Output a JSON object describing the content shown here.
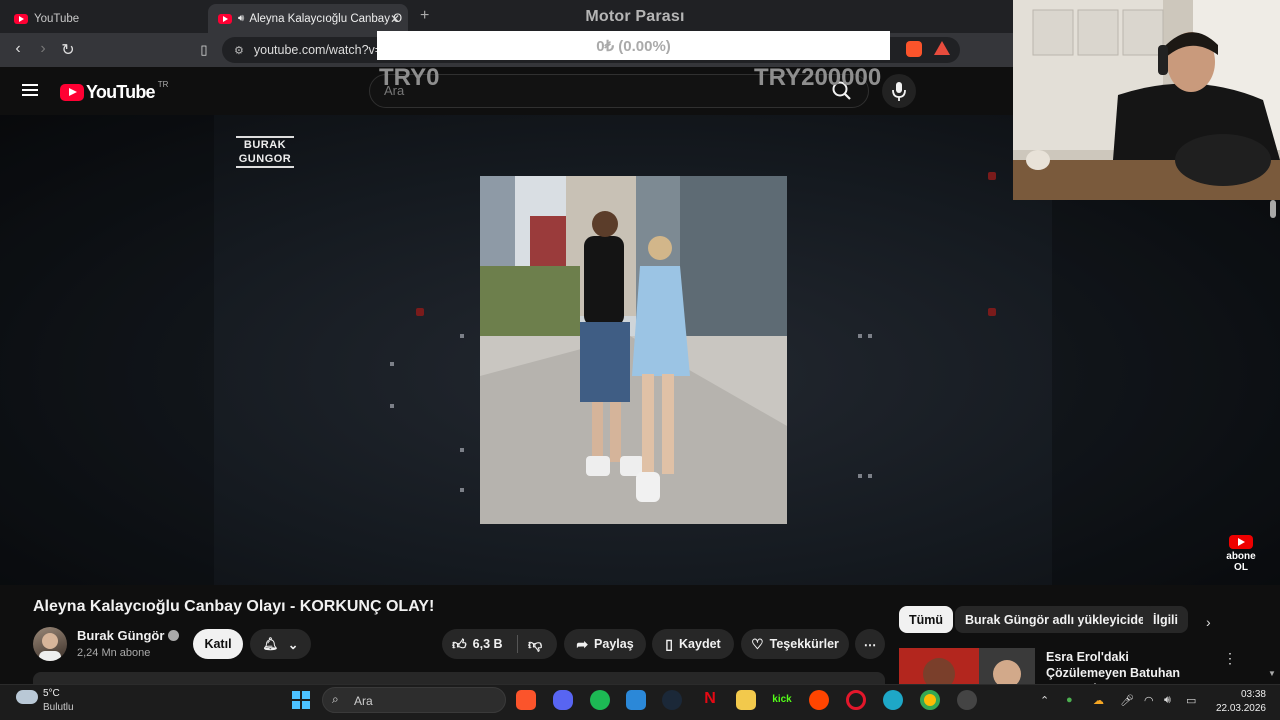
{
  "browser": {
    "tabs": [
      {
        "title": "YouTube"
      },
      {
        "title": "Aleyna Kalaycıoğlu Canbay O"
      }
    ],
    "url": "youtube.com/watch?v="
  },
  "overlay": {
    "title": "Motor Parası",
    "amount": "0₺ (0.00%)",
    "min_label": "TRY0",
    "max_label": "TRY200000",
    "progress": 0
  },
  "youtube": {
    "logo_text": "YouTube",
    "country_code": "TR",
    "search_placeholder": "Ara"
  },
  "video": {
    "brand_line1": "BURAK",
    "brand_line2": "GUNGOR",
    "abone_line1": "abone",
    "abone_line2": "OL",
    "title": "Aleyna Kalaycıoğlu Canbay Olayı - KORKUNÇ OLAY!"
  },
  "channel": {
    "name": "Burak Güngör",
    "subscribers": "2,24 Mn abone",
    "join_label": "Katıl"
  },
  "actions": {
    "likes": "6,3 B",
    "share": "Paylaş",
    "save": "Kaydet",
    "thanks": "Teşekkürler"
  },
  "chips": [
    "Tümü",
    "Burak Güngör adlı yükleyiciden",
    "İlgili"
  ],
  "recommendation": {
    "title": "Esra Erol'daki Çözülemeyen Batuhan Yener Olayı"
  },
  "taskbar": {
    "weather_temp": "5°C",
    "weather_cond": "Bulutlu",
    "search_placeholder": "Ara",
    "time": "03:38",
    "date": "22.03.2026"
  },
  "colors": {
    "yt_red": "#ff0033",
    "background": "#0f0f0f",
    "chip_active": "#f1f1f1"
  }
}
